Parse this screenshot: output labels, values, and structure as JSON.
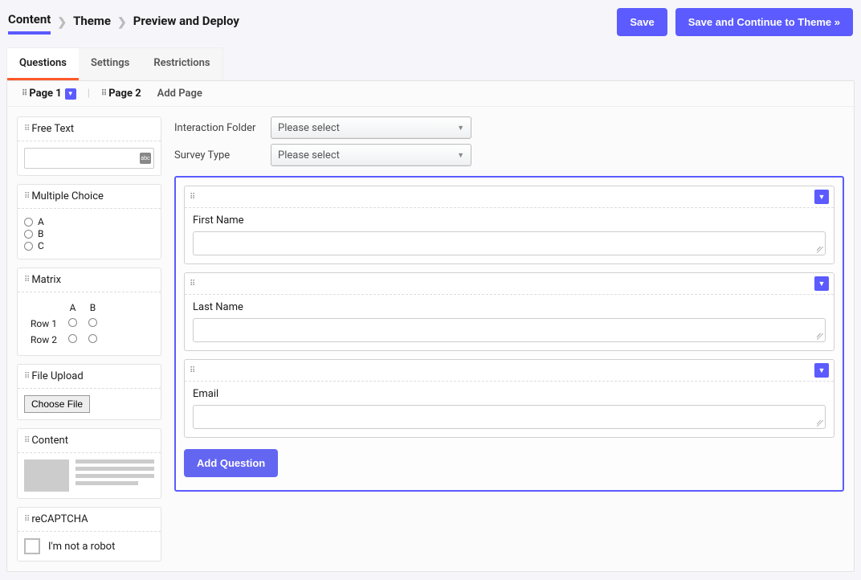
{
  "breadcrumbs": [
    {
      "label": "Content",
      "active": true
    },
    {
      "label": "Theme",
      "active": false
    },
    {
      "label": "Preview and Deploy",
      "active": false
    }
  ],
  "top_buttons": {
    "save": "Save",
    "save_continue": "Save and Continue to Theme »"
  },
  "tabs": [
    {
      "label": "Questions",
      "active": true
    },
    {
      "label": "Settings",
      "active": false
    },
    {
      "label": "Restrictions",
      "active": false
    }
  ],
  "pages": {
    "page1": "Page 1",
    "page2": "Page 2",
    "add": "Add Page"
  },
  "palette": {
    "free_text": "Free Text",
    "multiple_choice": {
      "title": "Multiple Choice",
      "options": [
        "A",
        "B",
        "C"
      ]
    },
    "matrix": {
      "title": "Matrix",
      "cols": [
        "A",
        "B"
      ],
      "rows": [
        "Row 1",
        "Row 2"
      ]
    },
    "file_upload": {
      "title": "File Upload",
      "button": "Choose File"
    },
    "content": "Content",
    "recaptcha": {
      "title": "reCAPTCHA",
      "checkbox_label": "I'm not a robot"
    }
  },
  "config": {
    "folder_label": "Interaction Folder",
    "type_label": "Survey Type",
    "select_placeholder": "Please select"
  },
  "questions": [
    {
      "label": "First Name"
    },
    {
      "label": "Last Name"
    },
    {
      "label": "Email"
    }
  ],
  "add_question": "Add Question"
}
